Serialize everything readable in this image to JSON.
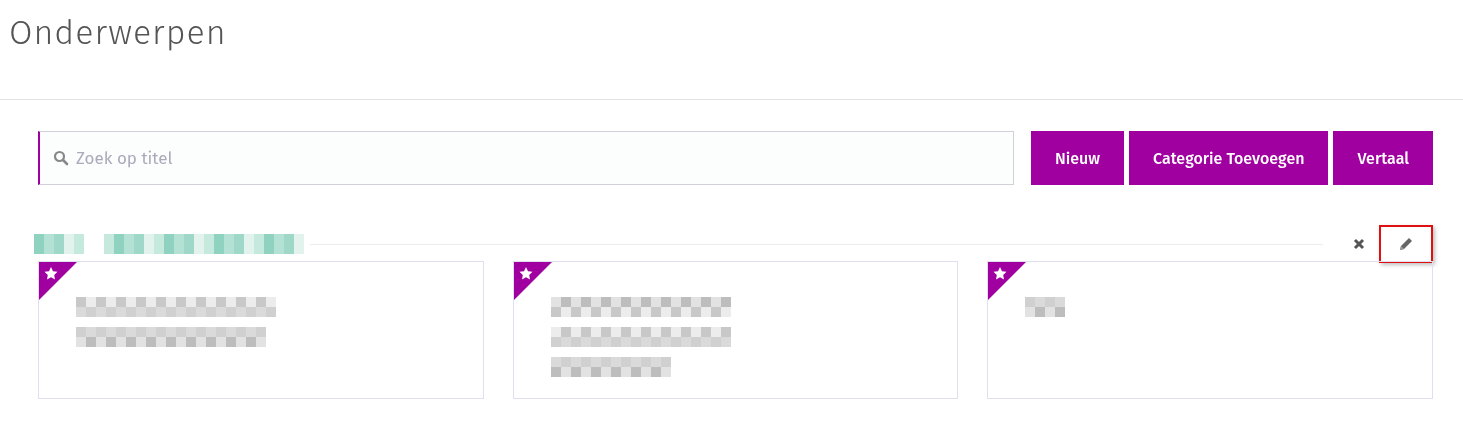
{
  "page": {
    "title": "Onderwerpen"
  },
  "search": {
    "placeholder": "Zoek op titel"
  },
  "buttons": [
    {
      "label": "Nieuw"
    },
    {
      "label": "Categorie Toevoegen"
    },
    {
      "label": "Vertaal"
    }
  ],
  "category": {
    "edit_highlighted": true,
    "cards": [
      {
        "starred": true
      },
      {
        "starred": true
      },
      {
        "starred": true
      }
    ]
  }
}
